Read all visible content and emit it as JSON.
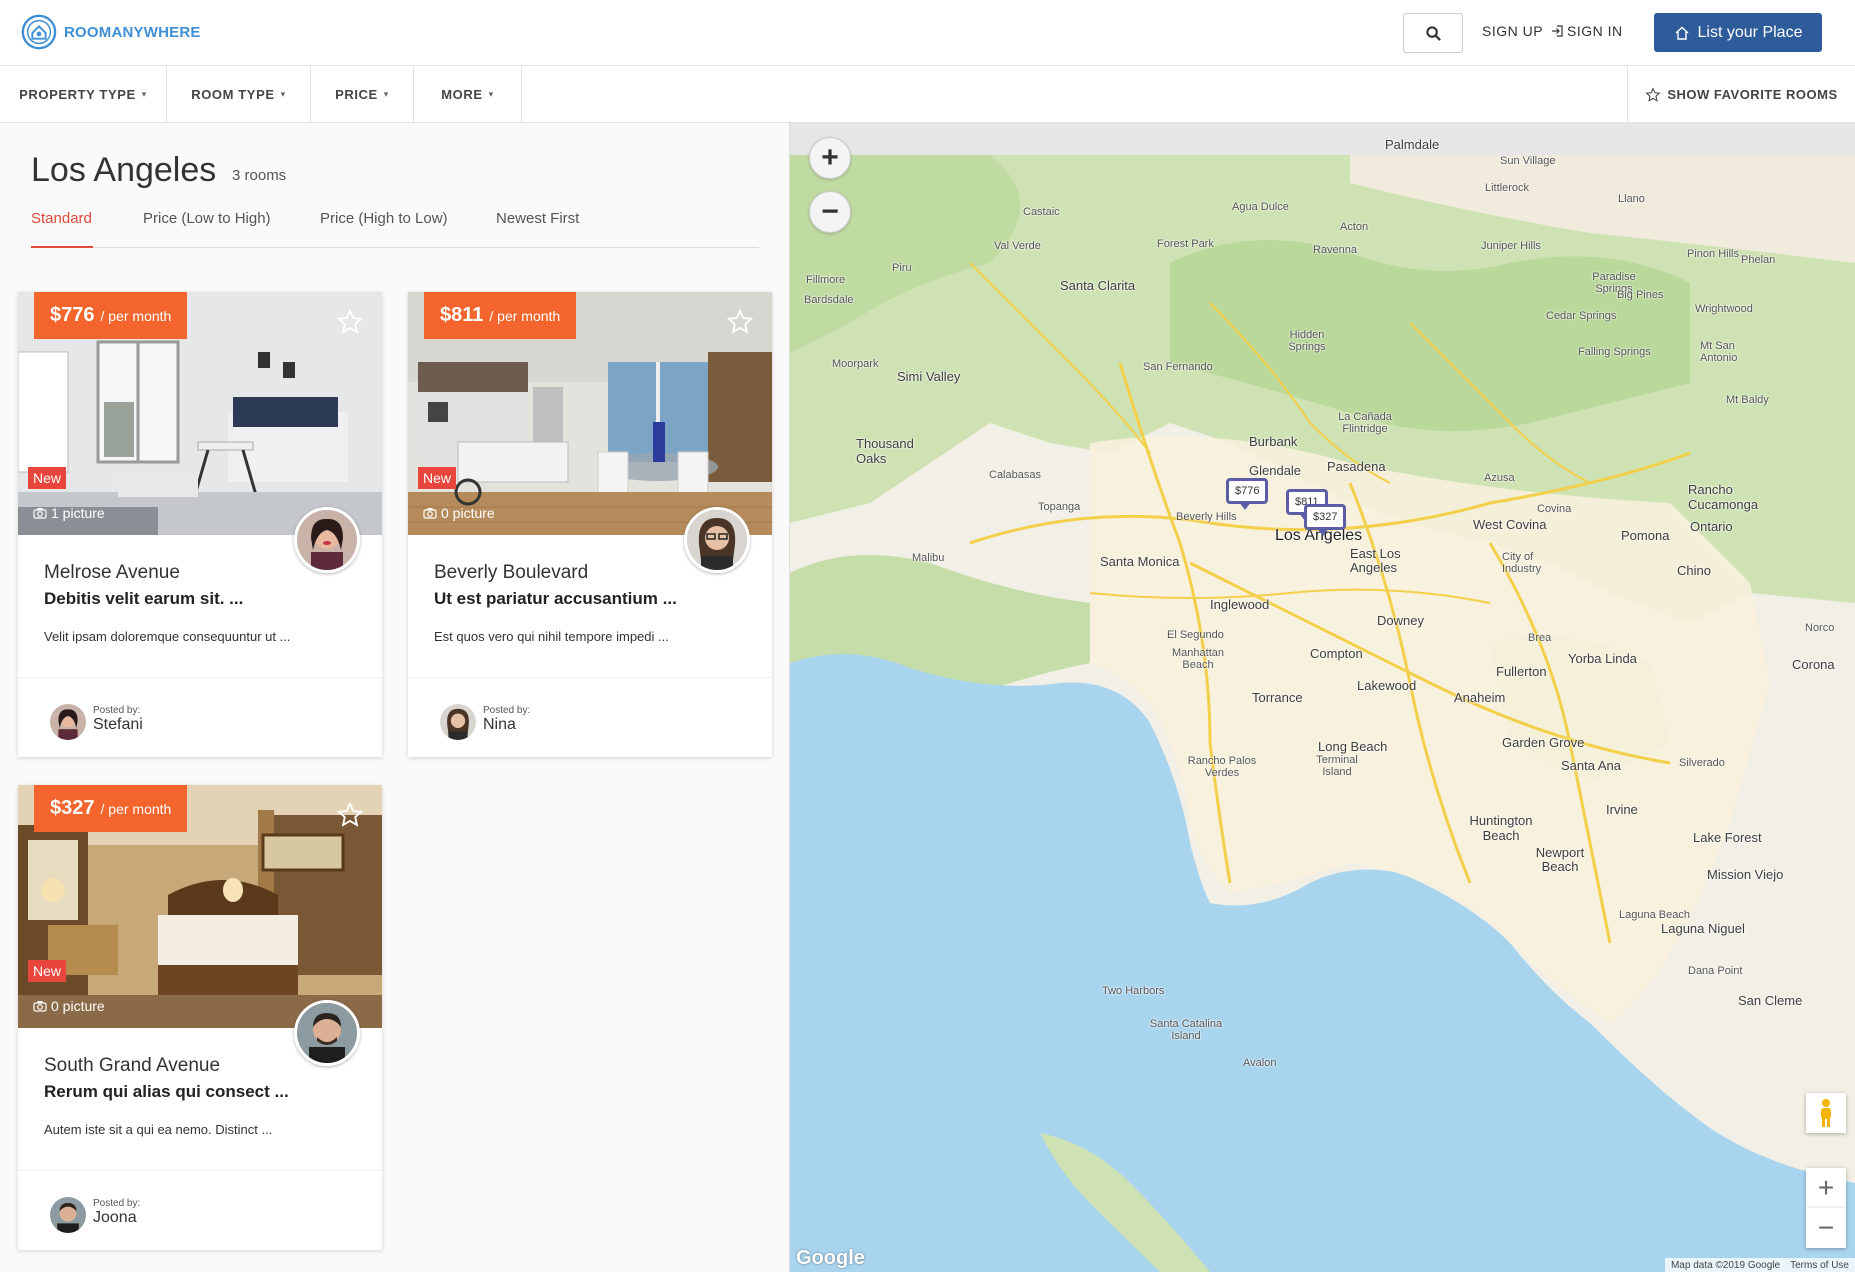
{
  "header": {
    "brand": "ROOMANYWHERE",
    "signup_label": "SIGN UP",
    "signin_label": "SIGN IN",
    "list_button_label": "List your Place",
    "brand_color": "#3f8fd6",
    "button_color": "#2e5b9a"
  },
  "filters": {
    "items": [
      "PROPERTY TYPE",
      "ROOM TYPE",
      "PRICE",
      "MORE"
    ],
    "favorites_label": "SHOW FAVORITE ROOMS"
  },
  "listing": {
    "city": "Los Angeles",
    "count": "3 rooms",
    "sort_tabs": [
      "Standard",
      "Price (Low to High)",
      "Price (High to Low)",
      "Newest First"
    ],
    "active_sort": "Standard",
    "accent_color": "#e14a3b"
  },
  "rooms": [
    {
      "price": "$776",
      "per": "/ per month",
      "badge": "New",
      "pictures": "1 picture",
      "street": "Melrose Avenue",
      "headline": "Debitis velit earum sit. ...",
      "description": "Velit ipsam doloremque consequuntur ut ...",
      "posted_by_label": "Posted by:",
      "poster": "Stefani"
    },
    {
      "price": "$811",
      "per": "/ per month",
      "badge": "New",
      "pictures": "0 picture",
      "street": "Beverly Boulevard",
      "headline": "Ut est pariatur accusantium ...",
      "description": "Est quos vero qui nihil tempore impedi ...",
      "posted_by_label": "Posted by:",
      "poster": "Nina"
    },
    {
      "price": "$327",
      "per": "/ per month",
      "badge": "New",
      "pictures": "0 picture",
      "street": "South Grand Avenue",
      "headline": "Rerum qui alias qui consect ...",
      "description": "Autem iste sit a qui ea nemo. Distinct ...",
      "posted_by_label": "Posted by:",
      "poster": "Joona"
    }
  ],
  "map": {
    "markers": [
      "$776",
      "$811",
      "$327"
    ],
    "labels": {
      "palmdale": "Palmdale",
      "sun_village": "Sun Village",
      "littlerock": "Littlerock",
      "llano": "Llano",
      "agua_dulce": "Agua Dulce",
      "acton": "Acton",
      "castaic": "Castaic",
      "val_verde": "Val Verde",
      "forest_park": "Forest Park",
      "ravenna": "Ravenna",
      "juniper_hills": "Juniper Hills",
      "pinon_hills": "Pinon Hills",
      "phelan": "Phelan",
      "fillmore": "Fillmore",
      "piru": "Piru",
      "bardsdale": "Bardsdale",
      "santa_clarita": "Santa Clarita",
      "paradise_springs": "Paradise Springs",
      "big_pines": "Big Pines",
      "wrightwood": "Wrightwood",
      "cedar_springs": "Cedar Springs",
      "hidden_springs": "Hidden Springs",
      "falling_springs": "Falling Springs",
      "mt_san_antonio": "Mt San Antonio",
      "moorpark": "Moorpark",
      "simi_valley": "Simi Valley",
      "san_fernando": "San Fernando",
      "la_canada": "La Cañada Flintridge",
      "mt_baldy": "Mt Baldy",
      "thousand_oaks": "Thousand Oaks",
      "burbank": "Burbank",
      "glendale": "Glendale",
      "pasadena": "Pasadena",
      "calabasas": "Calabasas",
      "azusa": "Azusa",
      "rancho_cucamonga": "Rancho Cucamonga",
      "topanga": "Topanga",
      "beverly_hills": "Beverly Hills",
      "los_angeles": "Los Angeles",
      "covina": "Covina",
      "west_covina": "West Covina",
      "ontario": "Ontario",
      "pomona": "Pomona",
      "malibu": "Malibu",
      "santa_monica": "Santa Monica",
      "east_la": "East Los Angeles",
      "city_industry": "City of Industry",
      "chino": "Chino",
      "inglewood": "Inglewood",
      "downey": "Downey",
      "el_segundo": "El Segundo",
      "norco": "Norco",
      "manhattan_beach": "Manhattan Beach",
      "compton": "Compton",
      "brea": "Brea",
      "yorba_linda": "Yorba Linda",
      "corona": "Corona",
      "fullerton": "Fullerton",
      "torrance": "Torrance",
      "lakewood": "Lakewood",
      "anaheim": "Anaheim",
      "long_beach": "Long Beach",
      "rancho_palos_verdes": "Rancho Palos Verdes",
      "terminal_island": "Terminal Island",
      "garden_grove": "Garden Grove",
      "santa_ana": "Santa Ana",
      "silverado": "Silverado",
      "irvine": "Irvine",
      "huntington_beach": "Huntington Beach",
      "lake_forest": "Lake Forest",
      "newport_beach": "Newport Beach",
      "mission_viejo": "Mission Viejo",
      "laguna_beach": "Laguna Beach",
      "laguna_niguel": "Laguna Niguel",
      "dana_point": "Dana Point",
      "two_harbors": "Two Harbors",
      "santa_catalina": "Santa Catalina Island",
      "san_clemente": "San Cleme",
      "avalon": "Avalon"
    },
    "google": "Google",
    "attribution": "Map data ©2019 Google",
    "terms": "Terms of Use"
  }
}
